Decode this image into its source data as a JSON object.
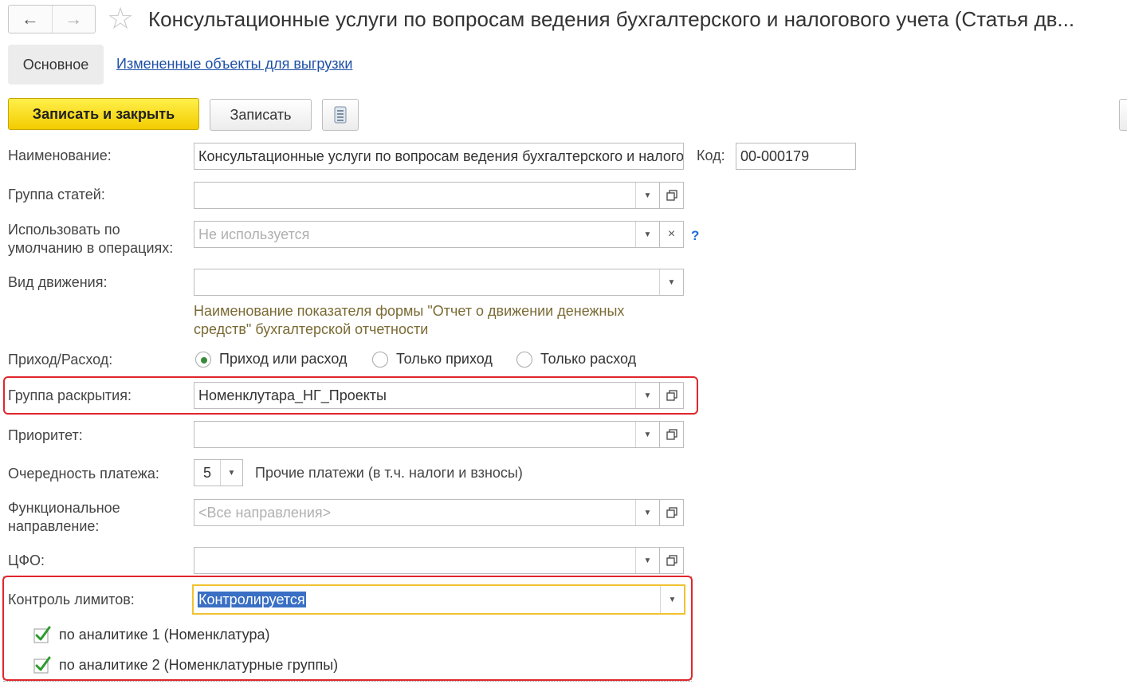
{
  "header": {
    "back_glyph": "←",
    "forward_glyph": "→",
    "star_glyph": "☆",
    "title": "Консультационные услуги по вопросам ведения бухгалтерского и налогового учета (Статья дв..."
  },
  "tabs": {
    "main": "Основное",
    "link": "Измененные объекты для выгрузки"
  },
  "toolbar": {
    "save_close": "Записать и закрыть",
    "save": "Записать",
    "more_glyph": "☰"
  },
  "form": {
    "name_label": "Наименование:",
    "name_value": "Консультационные услуги по вопросам ведения бухгалтерского и налогового учета",
    "code_label": "Код:",
    "code_value": "00-000179",
    "group_label": "Группа статей:",
    "group_value": "",
    "default_use_label_1": "Использовать по",
    "default_use_label_2": "умолчанию в операциях:",
    "default_use_placeholder": "Не используется",
    "clear_glyph": "×",
    "help_glyph": "?",
    "movement_label": "Вид движения:",
    "movement_value": "",
    "movement_note_1": "Наименование показателя формы \"Отчет о движении денежных",
    "movement_note_2": "средств\" бухгалтерской отчетности",
    "direction_label": "Приход/Расход:",
    "direction_options": [
      "Приход или расход",
      "Только приход",
      "Только расход"
    ],
    "direction_selected": 0,
    "disclosure_label": "Группа раскрытия:",
    "disclosure_value": "Номенклутара_НГ_Проекты",
    "priority_label": "Приоритет:",
    "priority_value": "",
    "payment_order_label": "Очередность платежа:",
    "payment_order_value": "5",
    "payment_order_note": "Прочие платежи (в т.ч. налоги и взносы)",
    "functional_label_1": "Функциональное",
    "functional_label_2": "направление:",
    "functional_placeholder": "<Все направления>",
    "cfo_label": "ЦФО:",
    "cfo_value": "",
    "limits_label": "Контроль лимитов:",
    "limits_value": "Контролируется",
    "checks": [
      {
        "label": "по аналитике 1 (Номенклатура)",
        "checked": true
      },
      {
        "label": "по аналитике 2 (Номенклатурные группы)",
        "checked": true
      }
    ]
  },
  "colors": {
    "accent_yellow": "#f3cc00",
    "highlight_red": "#e0262d",
    "link_blue": "#1d4fa6",
    "check_green": "#2d9a2d",
    "focus_yellow": "#f1c232"
  }
}
